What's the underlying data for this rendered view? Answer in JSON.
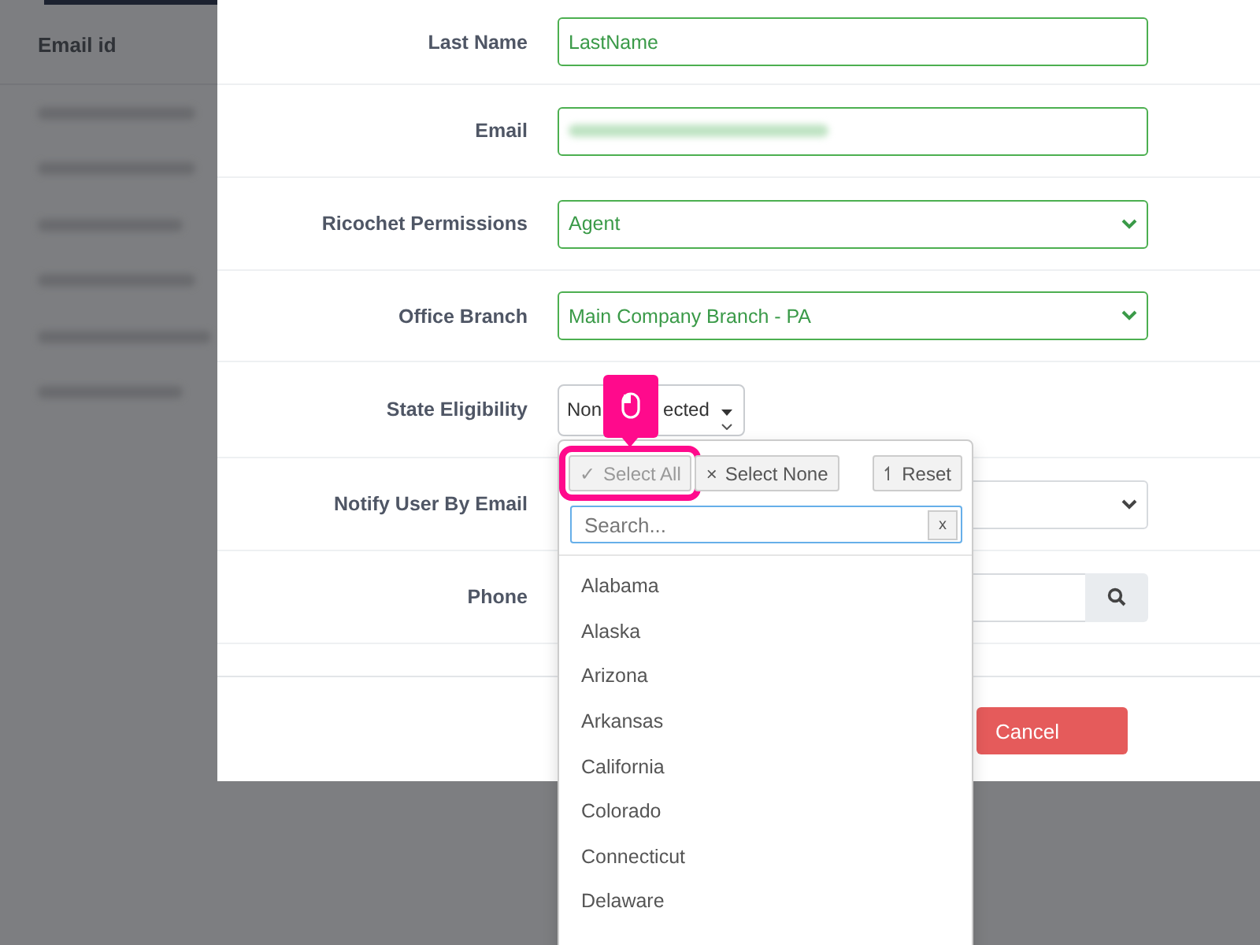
{
  "background_table": {
    "column": "Email id"
  },
  "form": {
    "fields": [
      {
        "label": "Last Name",
        "kind": "text",
        "value": "LastName"
      },
      {
        "label": "Email",
        "kind": "redacted"
      },
      {
        "label": "Ricochet Permissions",
        "kind": "select",
        "value": "Agent"
      },
      {
        "label": "Office Branch",
        "kind": "select",
        "value": "Main Company Branch - PA"
      },
      {
        "label": "State Eligibility",
        "kind": "multiselect",
        "value_parts": [
          "Non",
          "ected"
        ]
      },
      {
        "label": "Notify User By Email",
        "kind": "select"
      },
      {
        "label": "Phone",
        "kind": "phone"
      }
    ]
  },
  "cancel_button": "Cancel",
  "dropdown": {
    "buttons": [
      {
        "kind": "select_all",
        "symbol": "✓",
        "label": "Select All",
        "highlighted": true
      },
      {
        "kind": "select_none",
        "symbol": "×",
        "label": "Select None",
        "highlighted": false
      },
      {
        "kind": "reset",
        "label": "Reset",
        "highlighted": false
      }
    ],
    "search": {
      "placeholder": "Search...",
      "clear": "x"
    },
    "options": [
      "Alabama",
      "Alaska",
      "Arizona",
      "Arkansas",
      "California",
      "Colorado",
      "Connecticut",
      "Delaware"
    ]
  }
}
